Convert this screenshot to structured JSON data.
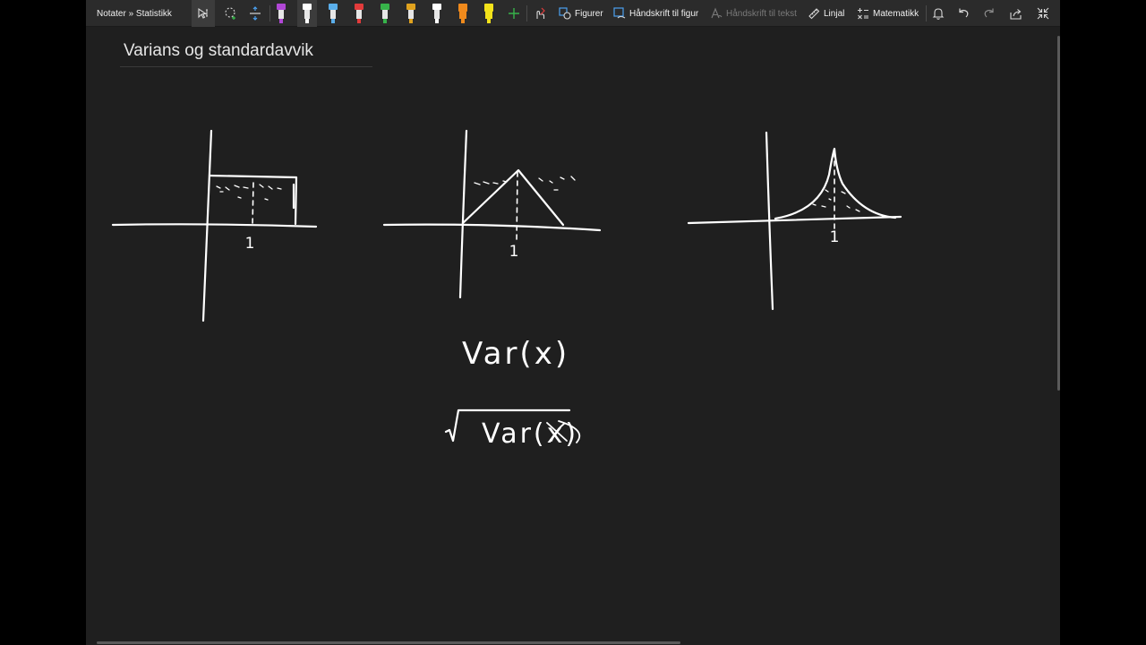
{
  "breadcrumb": "Notater » Statistikk",
  "page_title": "Varians og standardavvik",
  "toolbar": {
    "shapes_label": "Figurer",
    "ink_to_shape_label": "Håndskrift til figur",
    "ink_to_text_label": "Håndskrift til tekst",
    "ruler_label": "Linjal",
    "math_label": "Matematikk"
  },
  "pens": [
    {
      "name": "purple-pen",
      "color": "#b147d6"
    },
    {
      "name": "white-pen",
      "color": "#ffffff"
    },
    {
      "name": "light-blue-pen",
      "color": "#5aaeea"
    },
    {
      "name": "red-pen",
      "color": "#e23b3b"
    },
    {
      "name": "green-pen",
      "color": "#37b34a"
    },
    {
      "name": "gold-pen",
      "color": "#e0a21e"
    },
    {
      "name": "white-pen-2",
      "color": "#ffffff"
    },
    {
      "name": "orange-highlighter",
      "color": "#f08a1c"
    },
    {
      "name": "yellow-highlighter",
      "color": "#f3e21a"
    }
  ],
  "canvas": {
    "tick_label_1": "1",
    "tick_label_2": "1",
    "tick_label_3": "1",
    "var_text": "Var(x)",
    "sqrt_text": "Var(x)"
  },
  "colors": {
    "canvas_background": "#1f1f1f",
    "toolbar_background": "#2b2b2b",
    "ink": "#ffffff",
    "accent": "#4aa0f0"
  }
}
